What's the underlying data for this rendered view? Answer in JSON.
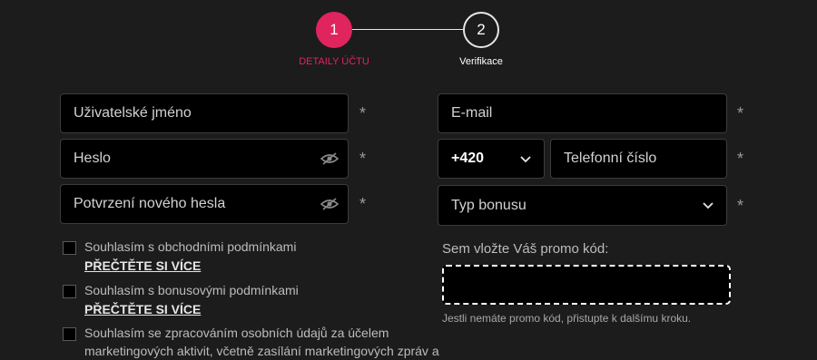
{
  "stepper": {
    "step1": {
      "number": "1",
      "label": "DETAILY ÚČTU"
    },
    "step2": {
      "number": "2",
      "label": "Verifikace"
    }
  },
  "form": {
    "username_placeholder": "Uživatelské jméno",
    "password_placeholder": "Heslo",
    "confirm_password_placeholder": "Potvrzení nového hesla",
    "email_placeholder": "E-mail",
    "phone_prefix": "+420",
    "phone_placeholder": "Telefonní číslo",
    "bonus_type": "Typ bonusu",
    "required_marker": "*"
  },
  "consents": [
    {
      "text": "Souhlasím s obchodními podmínkami",
      "link": "PŘEČTĚTE SI VÍCE"
    },
    {
      "text": "Souhlasím s bonusovými podmínkami",
      "link": "PŘEČTĚTE SI VÍCE"
    },
    {
      "text_line1": "Souhlasím se zpracováním osobních údajů za účelem",
      "text_line2": "marketingových aktivit, včetně zasílání marketingových zpráv a"
    }
  ],
  "promo": {
    "label": "Sem vložte Váš promo kód:",
    "hint": "Jestli nemáte promo kód, přistupte k dalšímu kroku."
  },
  "colors": {
    "accent": "#e0245e",
    "background": "#1c1c1c",
    "field": "#000000"
  }
}
